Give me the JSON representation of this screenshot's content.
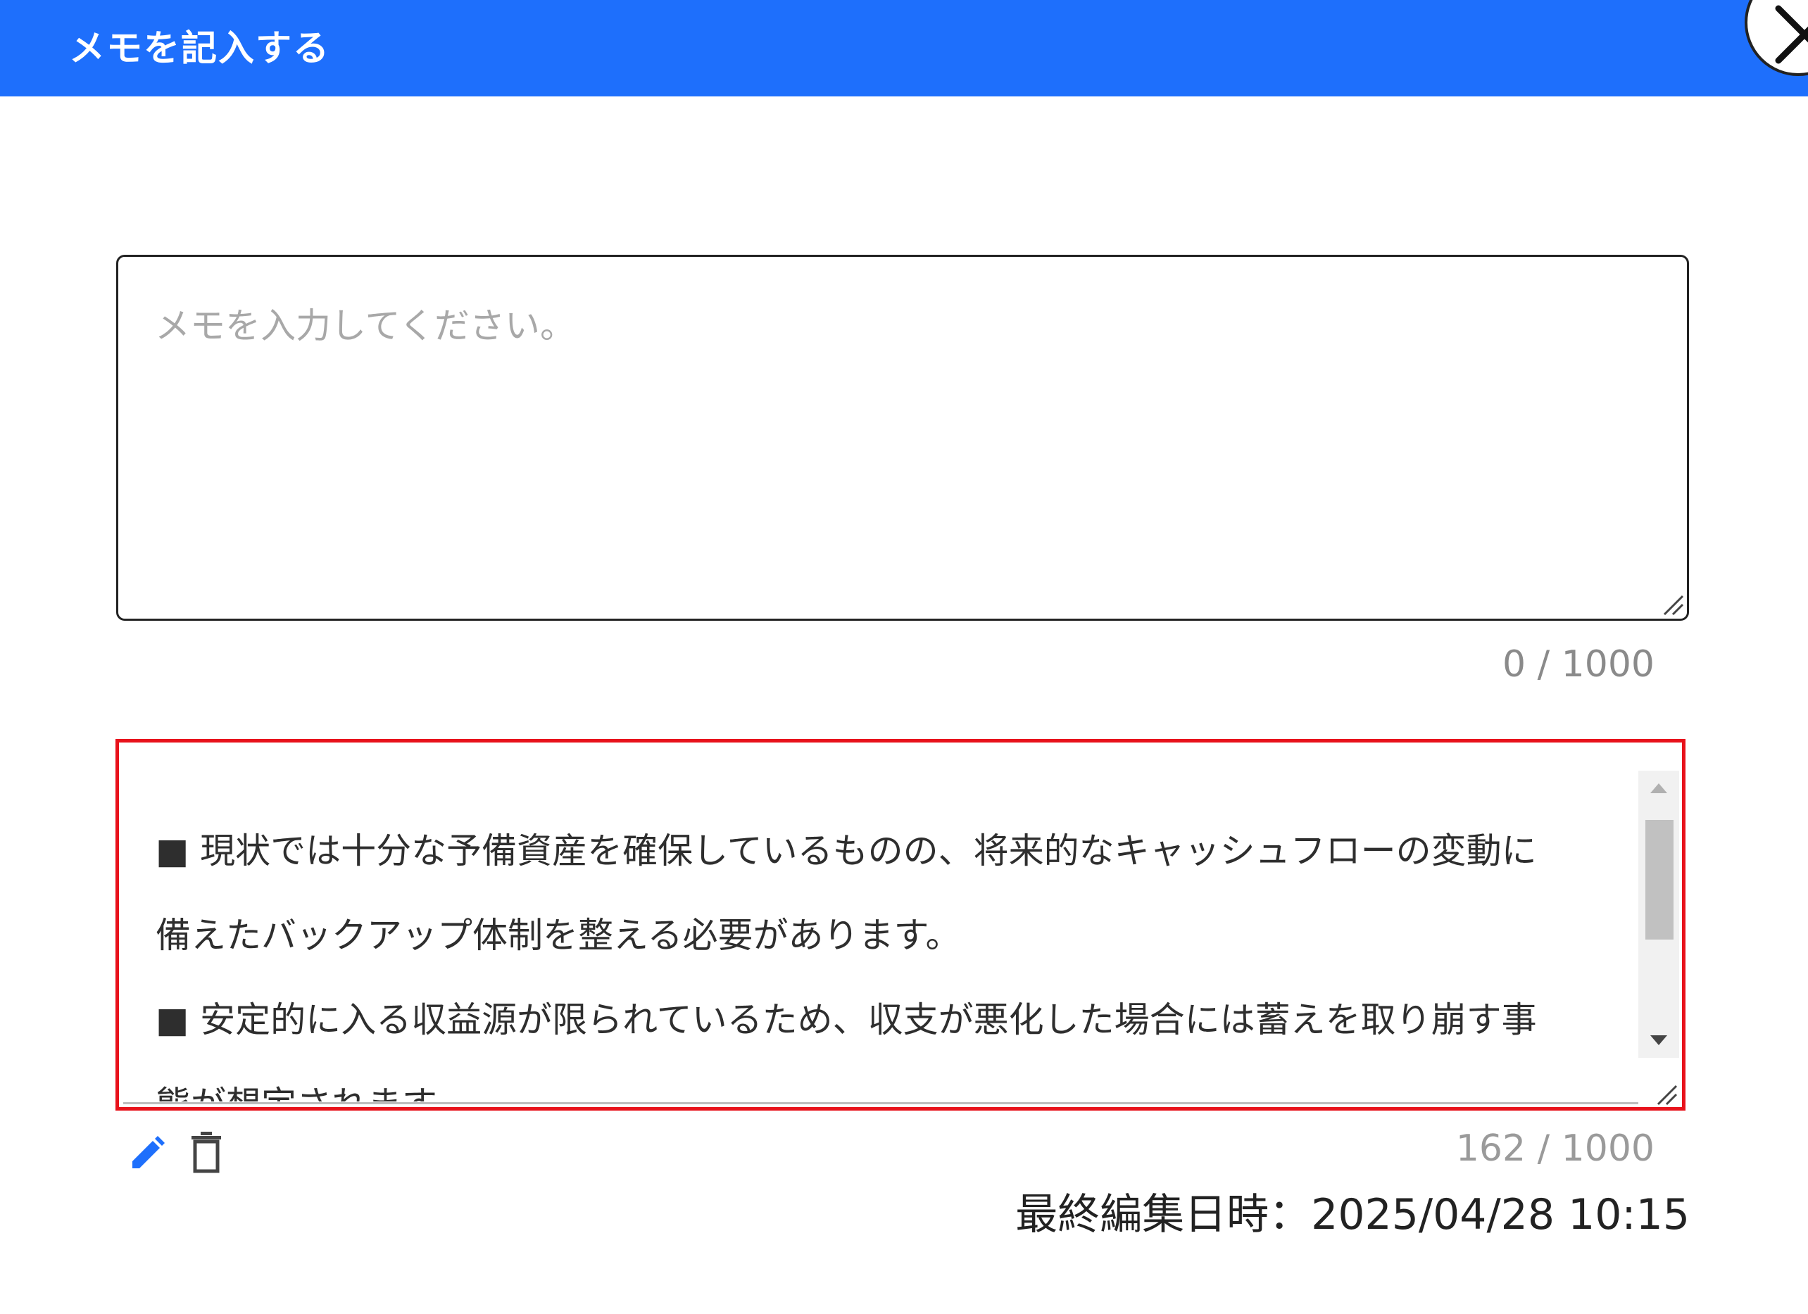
{
  "dialog": {
    "title": "メモを記入する",
    "close_icon": "close-icon"
  },
  "new_memo": {
    "placeholder": "メモを入力してください。",
    "value": "",
    "counter": "0 / 1000"
  },
  "existing_memo": {
    "lines": [
      "■ 現状では十分な予備資産を確保しているものの、将来的なキャッシュフローの変動に",
      "備えたバックアップ体制を整える必要があります。",
      "■ 安定的に入る収益源が限られているため、収支が悪化した場合には蓄えを取り崩す事",
      "態が想定されます。"
    ],
    "counter": "162 / 1000",
    "last_edited_label": "最終編集日時：2025/04/28 10:15",
    "actions": {
      "edit_icon": "pencil-icon",
      "delete_icon": "trash-icon"
    }
  },
  "colors": {
    "header": "#1e6ffc",
    "highlight_border": "#e8121b",
    "edit_icon": "#1e6ffc"
  }
}
